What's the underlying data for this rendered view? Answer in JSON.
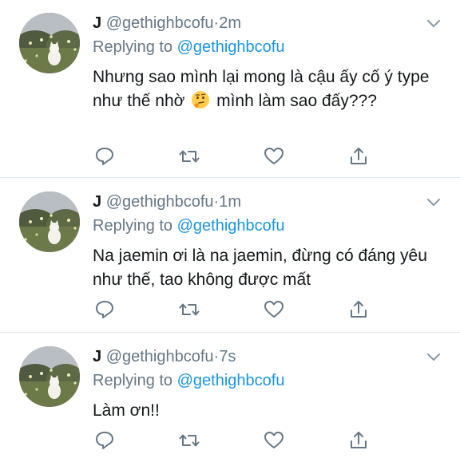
{
  "tweets": [
    {
      "name": "J",
      "handle": "@gethighbcofu",
      "dot": "·",
      "time": "2m",
      "reply_prefix": "Replying to",
      "reply_to": "@gethighbcofu",
      "text_before": "Nhưng sao mình lại mong là cậu ấy cố ý type như thế nhờ",
      "emoji": "thinking-face",
      "text_after": "mình làm sao đấy???"
    },
    {
      "name": "J",
      "handle": "@gethighbcofu",
      "dot": "·",
      "time": "1m",
      "reply_prefix": "Replying to",
      "reply_to": "@gethighbcofu",
      "text": "Na jaemin ơi là na jaemin, đừng có đáng yêu như thế, tao không được mất"
    },
    {
      "name": "J",
      "handle": "@gethighbcofu",
      "dot": "·",
      "time": "7s",
      "reply_prefix": "Replying to",
      "reply_to": "@gethighbcofu",
      "text": "Làm ơn!!"
    }
  ],
  "icons": [
    "chevron-down-icon",
    "reply-icon",
    "retweet-icon",
    "like-icon",
    "share-icon"
  ],
  "colors": {
    "text": "#14171a",
    "secondary": "#657786",
    "link": "#1b95e0",
    "divider": "#e1e8ed"
  }
}
